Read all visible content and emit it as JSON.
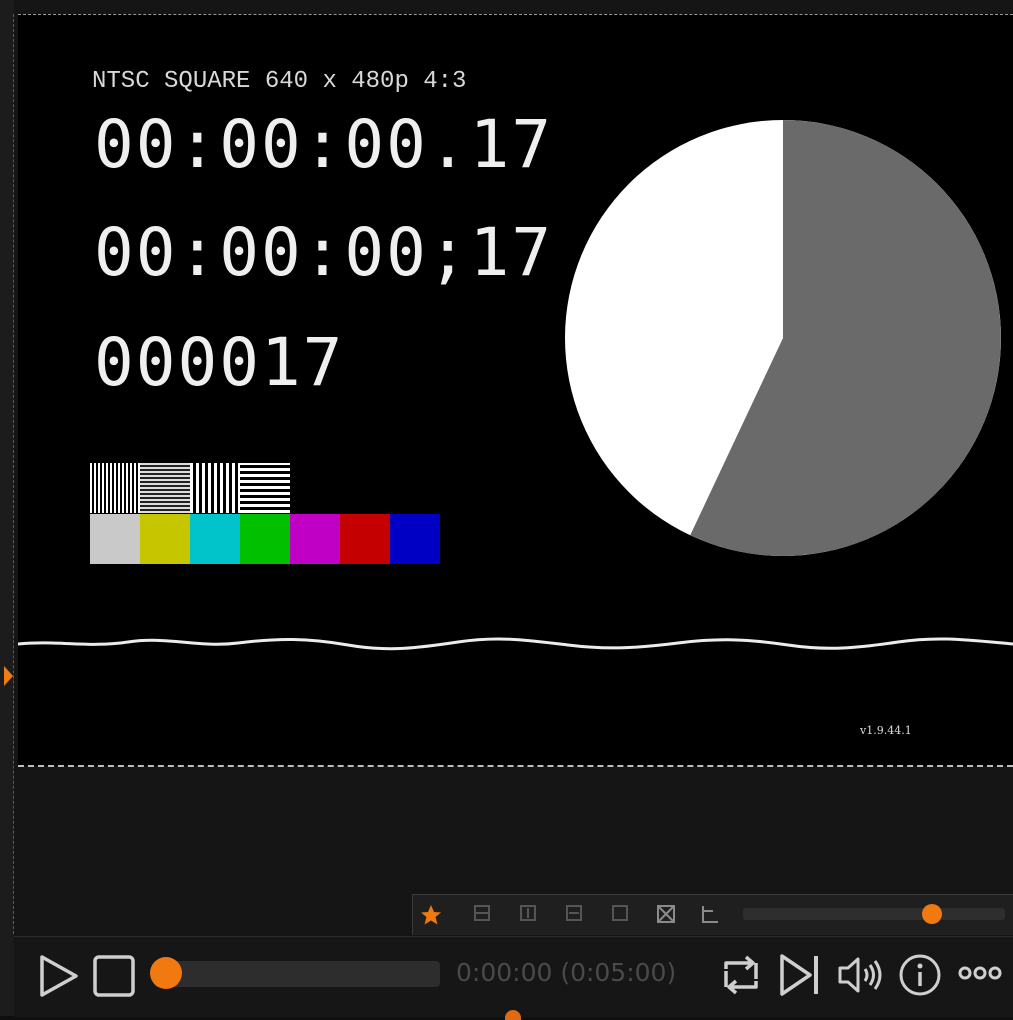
{
  "viewer": {
    "format_label": "NTSC SQUARE 640 x 480p 4:3",
    "timecode_ms": "00:00:00.17",
    "timecode_drop": "00:00:00;17",
    "frame_count": "000017",
    "version": "v1.9.44.1",
    "pie_fraction_gray": 0.57,
    "color_bars": [
      "#c9c9c9",
      "#c6c600",
      "#00c4c9",
      "#00c000",
      "#c000c4",
      "#c40000",
      "#0000c4"
    ]
  },
  "mini_toolbar": {
    "icons": [
      "star-icon",
      "keyframe-icon-1",
      "keyframe-icon-2",
      "keyframe-icon-3",
      "keyframe-icon-4",
      "crop-icon",
      "align-icon"
    ],
    "slider_value": 0.72
  },
  "transport": {
    "time_display": "0:00:00 (0:05:00)",
    "progress": 0.0,
    "icons": [
      "play-icon",
      "stop-icon",
      "loop-icon",
      "skip-end-icon",
      "volume-icon",
      "info-icon",
      "more-icon"
    ]
  },
  "colors": {
    "accent": "#f27910"
  }
}
